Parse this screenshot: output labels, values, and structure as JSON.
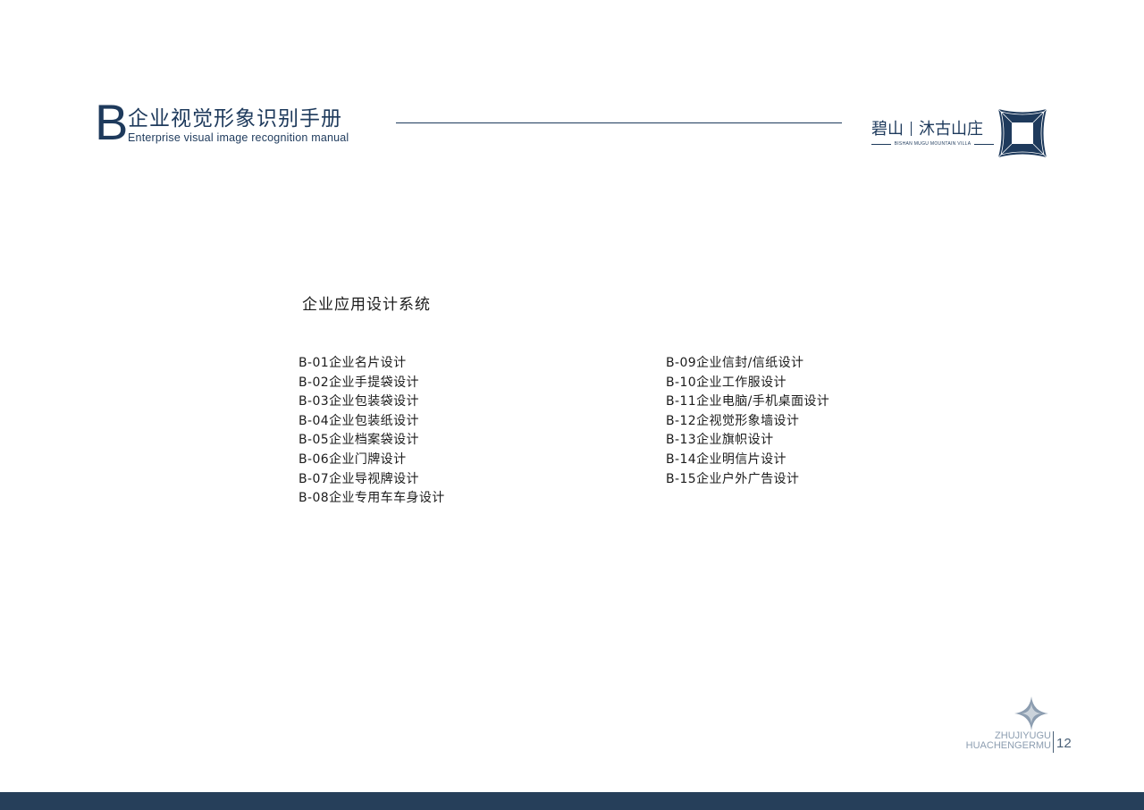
{
  "header": {
    "letter": "B",
    "title_cn": "企业视觉形象识别手册",
    "title_en": "Enterprise visual image recognition manual"
  },
  "brand": {
    "name_part1": "碧山",
    "name_part2": "沐古山庄",
    "name_en": "BISHAN MUGU MOUNTAIN VILLA",
    "logo_icon": "square-frame-logo-icon",
    "color": "#1e3a5c"
  },
  "section": {
    "title": "企业应用设计系统"
  },
  "toc": {
    "left": [
      "B-01企业名片设计",
      "B-02企业手提袋设计",
      "B-03企业包装袋设计",
      "B-04企业包装纸设计",
      "B-05企业档案袋设计",
      "B-06企业门牌设计",
      "B-07企业导视牌设计",
      "B-08企业专用车车身设计"
    ],
    "right": [
      "B-09企业信封/信纸设计",
      "B-10企业工作服设计",
      "B-11企业电脑/手机桌面设计",
      "B-12企视觉形象墙设计",
      "B-13企业旗帜设计",
      "B-14企业明信片设计",
      "B-15企业户外广告设计"
    ]
  },
  "footer": {
    "label_line1": "ZHUJIYUGU",
    "label_line2": "HUACHENGERMU",
    "page_number": "12",
    "mark_icon": "four-point-star-icon",
    "bar_color": "#263f5a"
  }
}
